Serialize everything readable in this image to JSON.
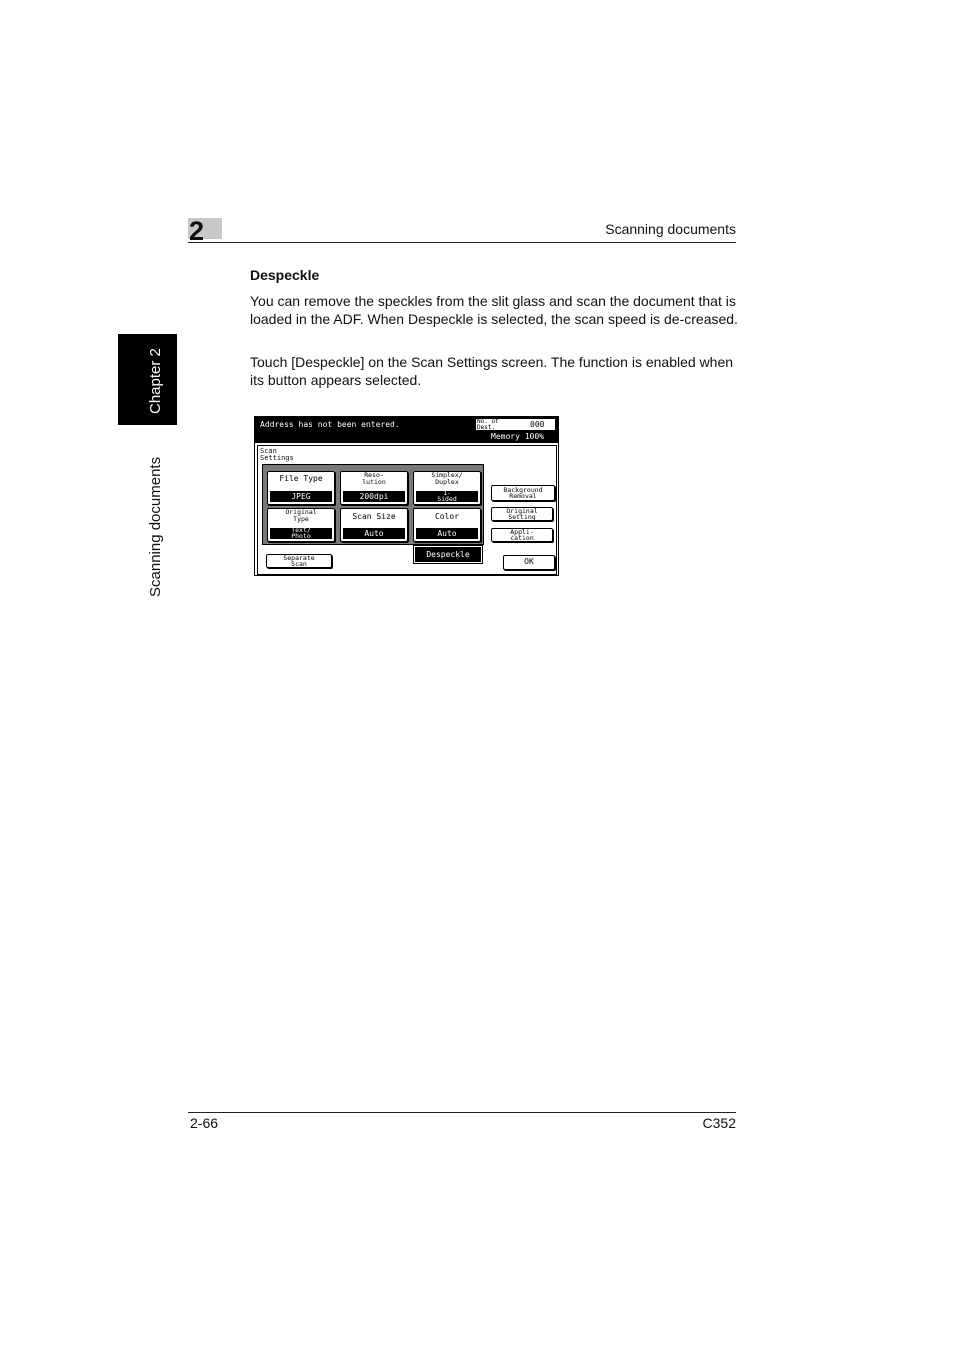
{
  "header": {
    "chapter_number": "2",
    "section_title": "Scanning documents"
  },
  "side_tab": {
    "chapter_label": "Chapter 2",
    "section_label": "Scanning documents"
  },
  "content": {
    "heading": "Despeckle",
    "paragraph1": "You can remove the speckles from the slit glass and scan the document that is loaded in the ADF. When Despeckle is selected, the scan speed is de-creased.",
    "paragraph2": "Touch [Despeckle] on the Scan Settings screen. The function is enabled when its button appears selected."
  },
  "screen": {
    "address_message": "Address has not been entered.",
    "dest_label": "No. of Dest.",
    "dest_count": "000",
    "memory": "Memory 100%",
    "settings_label": "Scan Settings",
    "tiles": [
      {
        "label": "File Type",
        "value": "JPEG"
      },
      {
        "label": "Reso- lution",
        "value": "200dpi"
      },
      {
        "label": "Simplex/ Duplex",
        "value": "1- Sided"
      },
      {
        "label": "Original Type",
        "value": "Text/ Photo"
      },
      {
        "label": "Scan Size",
        "value": "Auto"
      },
      {
        "label": "Color",
        "value": "Auto"
      }
    ],
    "background_removal": "Background Removal",
    "original_setting": "Original Setting",
    "application": "Appli- cation",
    "despeckle": "Despeckle",
    "separate_scan": "Separate Scan",
    "ok": "OK"
  },
  "footer": {
    "page_number": "2-66",
    "model": "C352"
  }
}
